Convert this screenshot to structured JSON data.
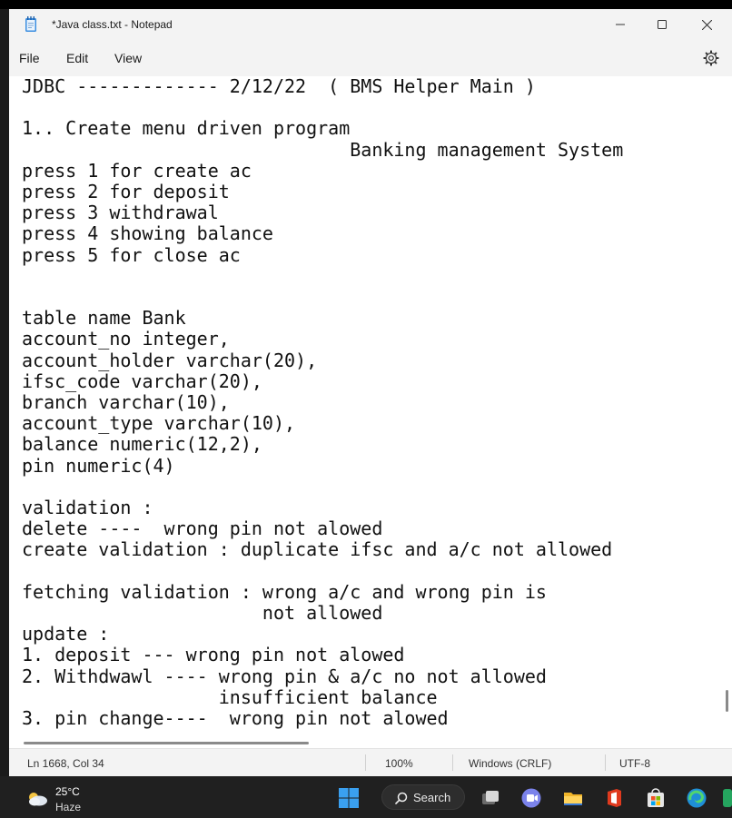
{
  "window": {
    "title": "*Java class.txt - Notepad",
    "controls": {
      "minimize": "—",
      "maximize": "☐",
      "close": "✕"
    }
  },
  "menu": {
    "file": "File",
    "edit": "Edit",
    "view": "View"
  },
  "editor": {
    "text": "JDBC ------------- 2/12/22  ( BMS Helper Main )\n\n1.. Create menu driven program\n                              Banking management System\npress 1 for create ac\npress 2 for deposit\npress 3 withdrawal\npress 4 showing balance\npress 5 for close ac\n\n\ntable name Bank\naccount_no integer,\naccount_holder varchar(20),\nifsc_code varchar(20),\nbranch varchar(10),\naccount_type varchar(10),\nbalance numeric(12,2),\npin numeric(4)\n\nvalidation :\ndelete ----  wrong pin not alowed\ncreate validation : duplicate ifsc and a/c not allowed\n\nfetching validation : wrong a/c and wrong pin is\n                      not allowed\nupdate :\n1. deposit --- wrong pin not alowed\n2. Withdwawl ---- wrong pin & a/c no not allowed\n                  insufficient balance\n3. pin change----  wrong pin not alowed"
  },
  "status": {
    "position": "Ln 1668, Col 34",
    "zoom": "100%",
    "line_ending": "Windows (CRLF)",
    "encoding": "UTF-8"
  },
  "taskbar": {
    "temperature": "25°C",
    "weather": "Haze",
    "search_label": "Search"
  },
  "colors": {
    "titlebar": "#f3f3f3",
    "taskbar": "#202020",
    "windows_blue": "#3aa0f0"
  }
}
